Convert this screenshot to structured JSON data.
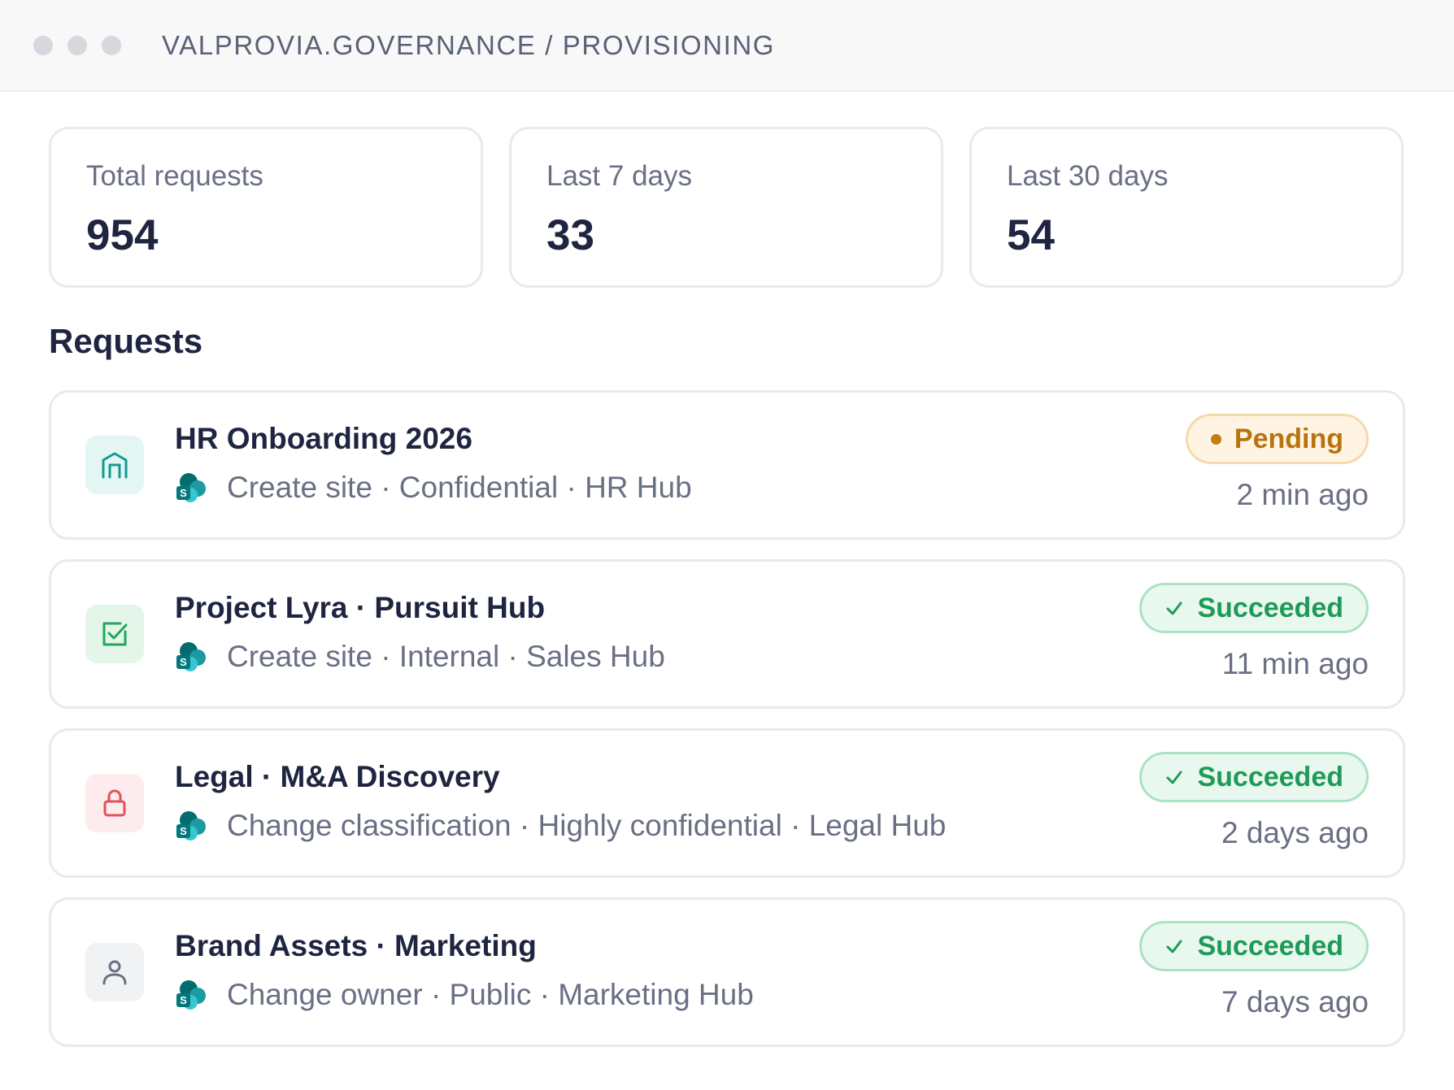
{
  "window": {
    "breadcrumb": "VALPROVIA.GOVERNANCE / PROVISIONING"
  },
  "stats": [
    {
      "label": "Total requests",
      "value": "954"
    },
    {
      "label": "Last 7 days",
      "value": "33"
    },
    {
      "label": "Last 30 days",
      "value": "54"
    }
  ],
  "requests_section": {
    "title": "Requests"
  },
  "requests": [
    {
      "title": "HR Onboarding 2026",
      "subtitle": "Create site · Confidential · HR Hub",
      "status": "Pending",
      "time": "2 min ago",
      "icon": "building-icon",
      "icon_color": "#159a8f",
      "icon_bg": "#e4f6f3"
    },
    {
      "title": "Project Lyra · Pursuit Hub",
      "subtitle": "Create site · Internal · Sales Hub",
      "status": "Succeeded",
      "time": "11 min ago",
      "icon": "checkbox-icon",
      "icon_color": "#23a65b",
      "icon_bg": "#e4f6ea"
    },
    {
      "title": "Legal · M&A Discovery",
      "subtitle": "Change classification · Highly confidential · Legal Hub",
      "status": "Succeeded",
      "time": "2 days ago",
      "icon": "lock-icon",
      "icon_color": "#e0525a",
      "icon_bg": "#fdecee"
    },
    {
      "title": "Brand Assets · Marketing",
      "subtitle": "Change owner · Public · Marketing Hub",
      "status": "Succeeded",
      "time": "7 days ago",
      "icon": "user-icon",
      "icon_color": "#6a7084",
      "icon_bg": "#f1f2f4"
    }
  ],
  "colors": {
    "pending": "#b7740e",
    "succeeded": "#1f9a58",
    "text_primary": "#1f2540",
    "text_secondary": "#6a7084"
  }
}
